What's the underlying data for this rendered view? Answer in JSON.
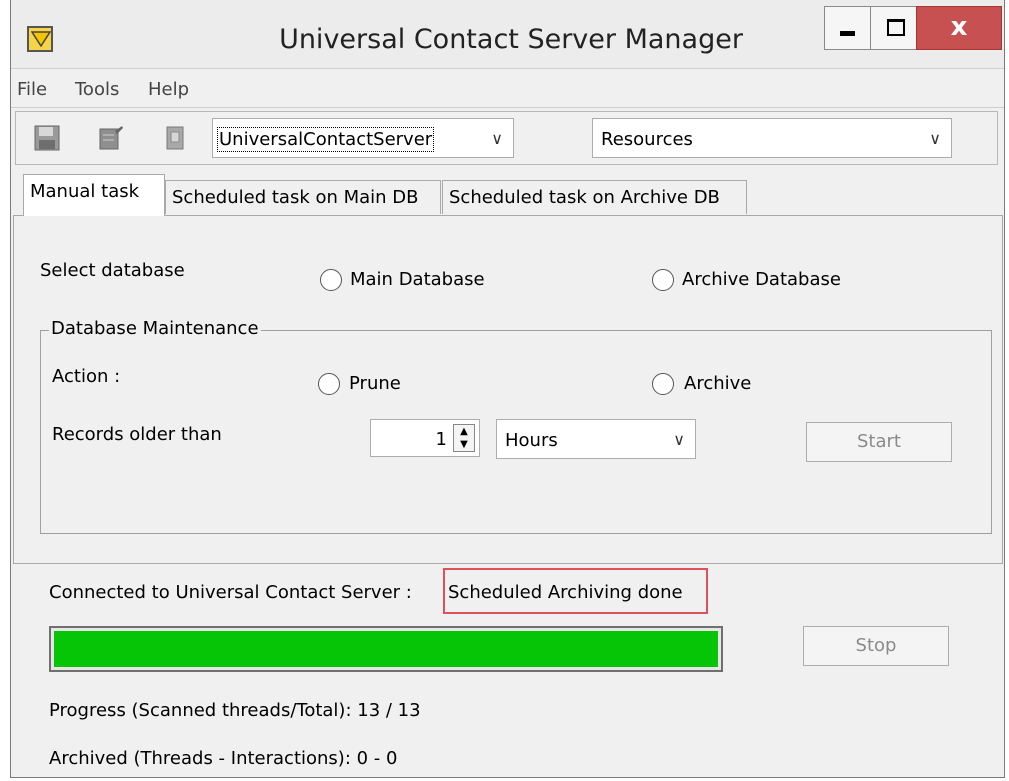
{
  "window": {
    "title": "Universal Contact Server Manager",
    "close_glyph": "x"
  },
  "menu": [
    "File",
    "Tools",
    "Help"
  ],
  "toolbar": {
    "icons": [
      "save-icon",
      "edit-icon",
      "copy-icon"
    ],
    "server_combo": "UniversalContactServer",
    "view_combo": "Resources"
  },
  "tabs": [
    {
      "label": "Manual task",
      "active": true
    },
    {
      "label": "Scheduled task on Main DB",
      "active": false
    },
    {
      "label": "Scheduled task on Archive DB",
      "active": false
    }
  ],
  "panel": {
    "select_db_label": "Select database",
    "main_db_option": "Main Database",
    "archive_db_option": "Archive Database",
    "group_title": "Database Maintenance",
    "action_label": "Action :",
    "prune_option": "Prune",
    "archive_option": "Archive",
    "records_label": "Records older than",
    "records_value": "1",
    "unit_combo": "Hours",
    "start_button": "Start"
  },
  "status": {
    "label": "Connected to Universal Contact Server :",
    "value": "Scheduled Archiving done",
    "highlight_color": "#e0505a"
  },
  "progress": {
    "fraction": 1.0,
    "color": "#06c406"
  },
  "stop_button": "Stop",
  "footer": {
    "progress_text": "Progress (Scanned threads/Total): 13 / 13",
    "archived_text": "Archived (Threads - Interactions): 0 - 0"
  }
}
